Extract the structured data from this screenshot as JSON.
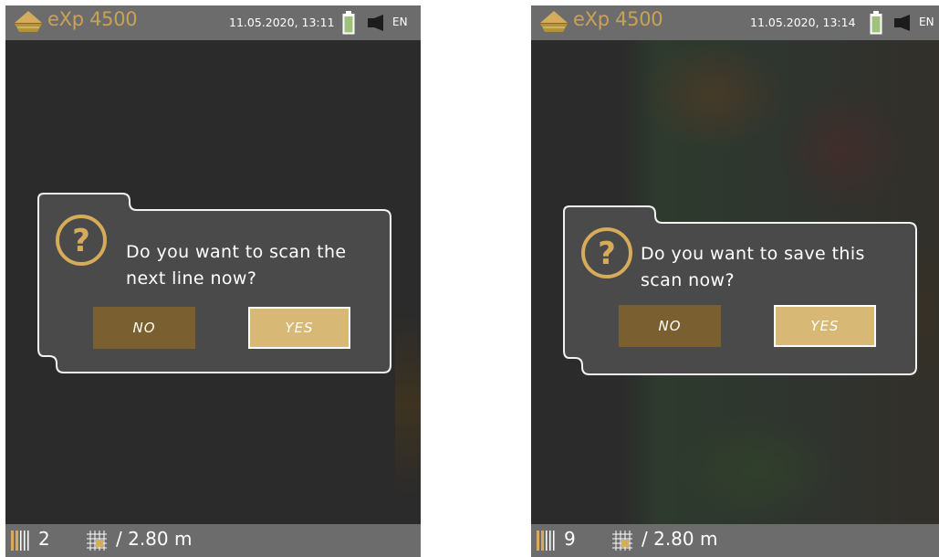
{
  "colors": {
    "gold": "#c9a353",
    "bar": "#6c6c6c",
    "screen": "#2b2b2b",
    "no_button": "#7a6030",
    "yes_button": "#d7b874",
    "battery": "#9ec27a"
  },
  "screens": [
    {
      "title": "eXp 4500",
      "datetime": "11.05.2020, 13:11",
      "language": "EN",
      "dialog": {
        "icon": "question-icon",
        "message": "Do you want to scan the next line now?",
        "no_label": "NO",
        "yes_label": "YES"
      },
      "footer": {
        "lines_count": "2",
        "distance": "/ 2.80 m"
      }
    },
    {
      "title": "eXp 4500",
      "datetime": "11.05.2020, 13:14",
      "language": "EN",
      "dialog": {
        "icon": "question-icon",
        "message": "Do you want to save this scan now?",
        "no_label": "NO",
        "yes_label": "YES"
      },
      "footer": {
        "lines_count": "9",
        "distance": "/ 2.80 m"
      }
    }
  ]
}
